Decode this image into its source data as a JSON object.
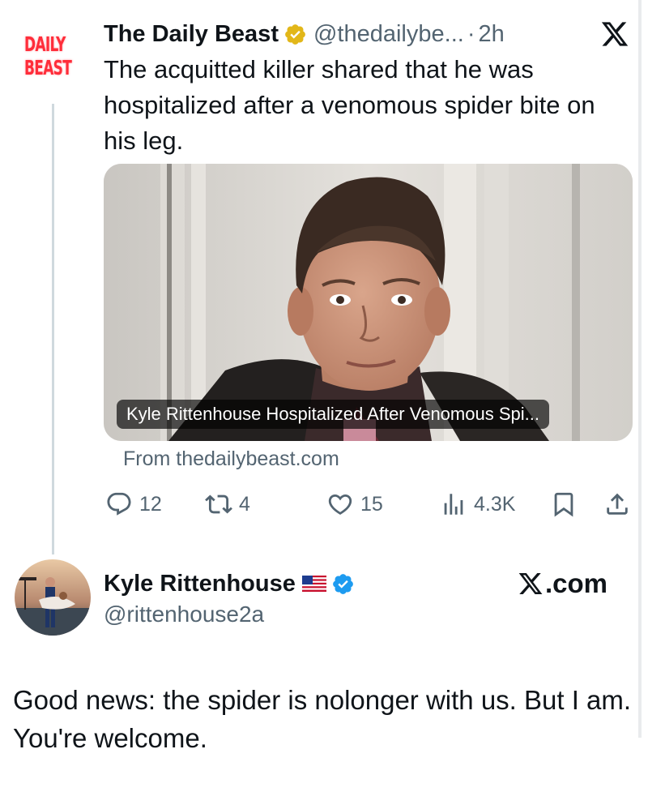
{
  "first_tweet": {
    "logo_text": [
      "DAILY",
      "BEAST"
    ],
    "author_name": "The Daily Beast",
    "handle": "@thedailybe...",
    "separator": "·",
    "time": "2h",
    "text": "The acquitted killer shared that he was hospitalized after a venomous spider bite on his leg.",
    "card": {
      "headline": "Kyle Rittenhouse Hospitalized After Venomous Spi...",
      "source": "From thedailybeast.com"
    },
    "actions": {
      "replies": "12",
      "reposts": "4",
      "likes": "15",
      "views": "4.3K"
    },
    "icons": [
      "x-logo-icon",
      "verified-gold-badge-icon",
      "reply-icon",
      "repost-icon",
      "like-icon",
      "views-icon",
      "bookmark-icon",
      "share-icon"
    ]
  },
  "reply_tweet": {
    "author_name": "Kyle Rittenhouse",
    "handle": "@rittenhouse2a",
    "watermark": ".com",
    "text": "Good news: the spider is nolonger with us. But I am. You're welcome.",
    "icons": [
      "us-flag-icon",
      "verified-blue-badge-icon"
    ]
  },
  "colors": {
    "text": "#0f1419",
    "secondary": "#536471",
    "logo_red": "#ff2d3a",
    "verified_blue": "#1d9bf0",
    "verified_gold": "#e2b719"
  }
}
